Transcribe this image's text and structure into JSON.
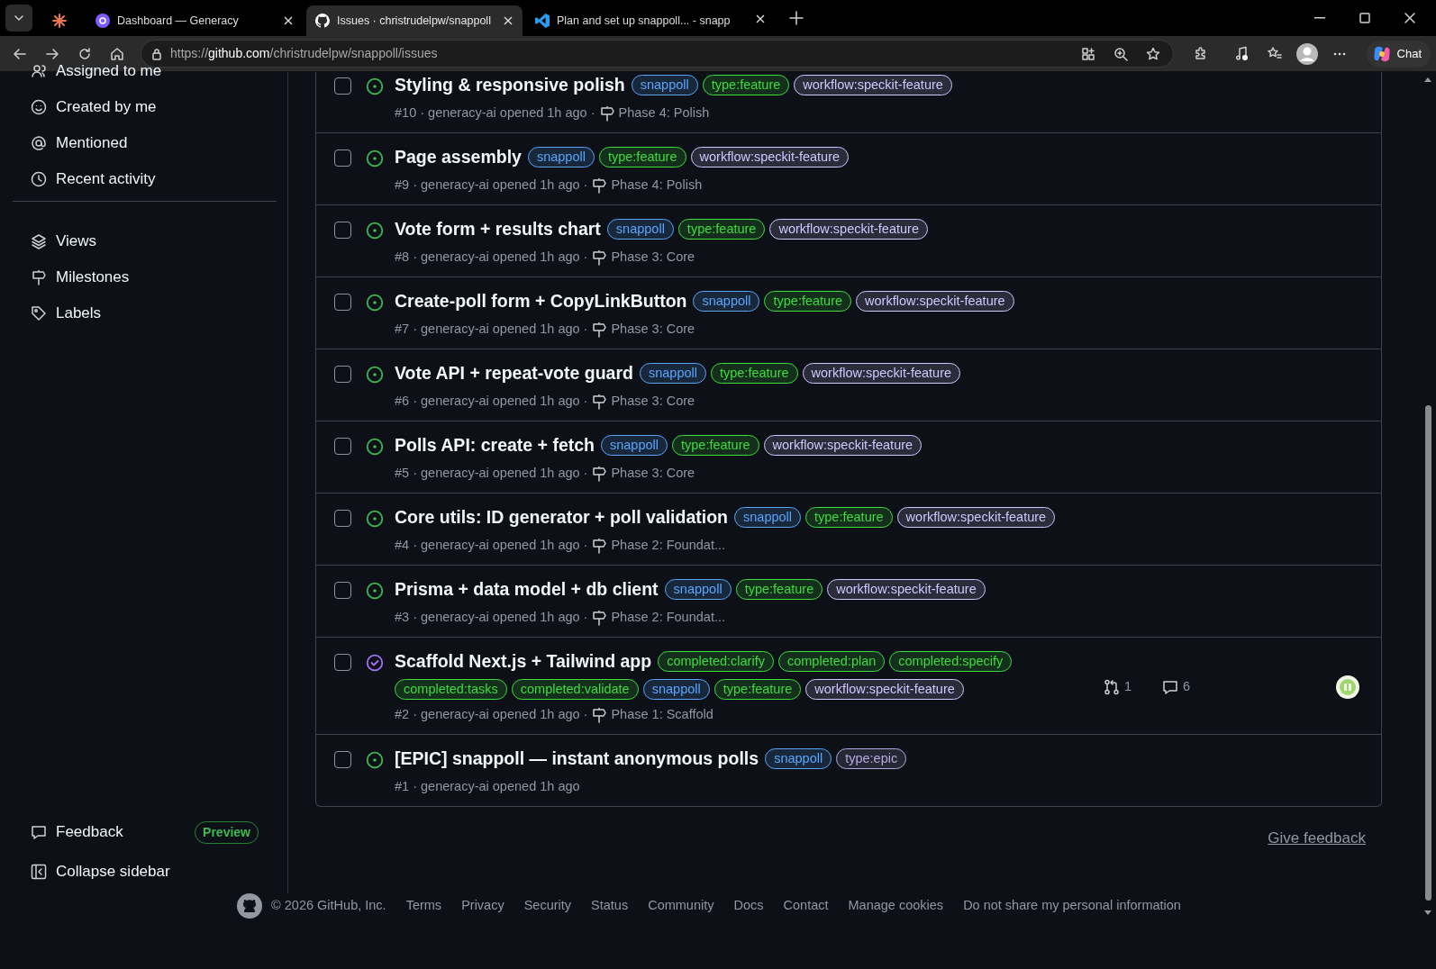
{
  "browser": {
    "tabs": [
      {
        "kind": "pinned",
        "selected": false
      },
      {
        "kind": "generacy",
        "title": "Dashboard — Generacy",
        "selected": false
      },
      {
        "kind": "github",
        "title": "Issues · christrudelpw/snappoll",
        "selected": true
      },
      {
        "kind": "vscode",
        "title": "Plan and set up snappoll... - snapp",
        "selected": false
      }
    ],
    "url": "https://github.com/christrudelpw/snappoll/issues",
    "chat_button": "Chat"
  },
  "sidebar": {
    "groups": [
      {
        "items": [
          "Assigned to me",
          "Created by me",
          "Mentioned",
          "Recent activity"
        ]
      },
      {
        "items": [
          "Views",
          "Milestones",
          "Labels"
        ]
      }
    ],
    "feedback": {
      "label": "Feedback",
      "badge": "Preview"
    },
    "collapse": "Collapse sidebar"
  },
  "issues": [
    {
      "title": "Styling & responsive polish",
      "closed": false,
      "labels": [
        {
          "name": "snappoll",
          "color": "#58a6ff"
        },
        {
          "name": "type:feature",
          "color": "#3fdc3f"
        },
        {
          "name": "workflow:speckit-feature",
          "color": "#d2c6ff"
        }
      ],
      "meta": "#10 · generacy-ai opened 1h ago ·",
      "checked": false,
      "milestone": "Phase 4: Polish"
    },
    {
      "title": "Page assembly",
      "closed": false,
      "labels": [
        {
          "name": "snappoll",
          "color": "#58a6ff"
        },
        {
          "name": "type:feature",
          "color": "#3fdc3f"
        },
        {
          "name": "workflow:speckit-feature",
          "color": "#d2c6ff"
        }
      ],
      "meta": "#9 · generacy-ai opened 1h ago ·",
      "checked": false,
      "milestone": "Phase 4: Polish"
    },
    {
      "title": "Vote form + results chart",
      "closed": false,
      "labels": [
        {
          "name": "snappoll",
          "color": "#58a6ff"
        },
        {
          "name": "type:feature",
          "color": "#3fdc3f"
        },
        {
          "name": "workflow:speckit-feature",
          "color": "#d2c6ff"
        }
      ],
      "meta": "#8 · generacy-ai opened 1h ago ·",
      "checked": false,
      "milestone": "Phase 3: Core"
    },
    {
      "title": "Create-poll form + CopyLinkButton",
      "closed": false,
      "labels": [
        {
          "name": "snappoll",
          "color": "#58a6ff"
        },
        {
          "name": "type:feature",
          "color": "#3fdc3f"
        },
        {
          "name": "workflow:speckit-feature",
          "color": "#d2c6ff"
        }
      ],
      "meta": "#7 · generacy-ai opened 1h ago ·",
      "checked": false,
      "milestone": "Phase 3: Core"
    },
    {
      "title": "Vote API + repeat-vote guard",
      "closed": false,
      "labels": [
        {
          "name": "snappoll",
          "color": "#58a6ff"
        },
        {
          "name": "type:feature",
          "color": "#3fdc3f"
        },
        {
          "name": "workflow:speckit-feature",
          "color": "#d2c6ff"
        }
      ],
      "meta": "#6 · generacy-ai opened 1h ago ·",
      "checked": false,
      "milestone": "Phase 3: Core"
    },
    {
      "title": "Polls API: create + fetch",
      "closed": false,
      "labels": [
        {
          "name": "snappoll",
          "color": "#58a6ff"
        },
        {
          "name": "type:feature",
          "color": "#3fdc3f"
        },
        {
          "name": "workflow:speckit-feature",
          "color": "#d2c6ff"
        }
      ],
      "meta": "#5 · generacy-ai opened 1h ago ·",
      "checked": false,
      "milestone": "Phase 3: Core"
    },
    {
      "title": "Core utils: ID generator + poll validation",
      "closed": false,
      "labels": [
        {
          "name": "snappoll",
          "color": "#58a6ff"
        },
        {
          "name": "type:feature",
          "color": "#3fdc3f"
        },
        {
          "name": "workflow:speckit-feature",
          "color": "#d2c6ff"
        }
      ],
      "meta": "#4 · generacy-ai opened 1h ago ·",
      "checked": false,
      "milestone": "Phase 2: Foundat..."
    },
    {
      "title": "Prisma + data model + db client",
      "closed": false,
      "labels": [
        {
          "name": "snappoll",
          "color": "#58a6ff"
        },
        {
          "name": "type:feature",
          "color": "#3fdc3f"
        },
        {
          "name": "workflow:speckit-feature",
          "color": "#d2c6ff"
        }
      ],
      "meta": "#3 · generacy-ai opened 1h ago ·",
      "checked": false,
      "milestone": "Phase 2: Foundat..."
    },
    {
      "title": "Scaffold Next.js + Tailwind app",
      "closed": true,
      "labels": [
        {
          "name": "completed:clarify",
          "color": "#3fdc3f"
        },
        {
          "name": "completed:plan",
          "color": "#3fdc3f"
        },
        {
          "name": "completed:specify",
          "color": "#3fdc3f"
        },
        {
          "name": "completed:tasks",
          "color": "#3fdc3f"
        },
        {
          "name": "completed:validate",
          "color": "#3fdc3f"
        },
        {
          "name": "snappoll",
          "color": "#58a6ff"
        },
        {
          "name": "type:feature",
          "color": "#3fdc3f"
        },
        {
          "name": "workflow:speckit-feature",
          "color": "#d2c6ff"
        }
      ],
      "meta": "#2 · generacy-ai opened 1h ago ·",
      "checked": false,
      "milestone": "Phase 1: Scaffold",
      "linked_prs": "1",
      "comments": "6",
      "assigned": true
    },
    {
      "title": "[EPIC] snappoll — instant anonymous polls",
      "closed": false,
      "labels": [
        {
          "name": "snappoll",
          "color": "#58a6ff"
        },
        {
          "name": "type:epic",
          "color": "#b7a9e0"
        }
      ],
      "meta": "#1 · generacy-ai opened 1h ago",
      "checked": false
    }
  ],
  "give_feedback": "Give feedback",
  "footer": {
    "copyright": "© 2026 GitHub, Inc.",
    "links": [
      "Terms",
      "Privacy",
      "Security",
      "Status",
      "Community",
      "Docs",
      "Contact",
      "Manage cookies",
      "Do not share my personal information"
    ]
  }
}
